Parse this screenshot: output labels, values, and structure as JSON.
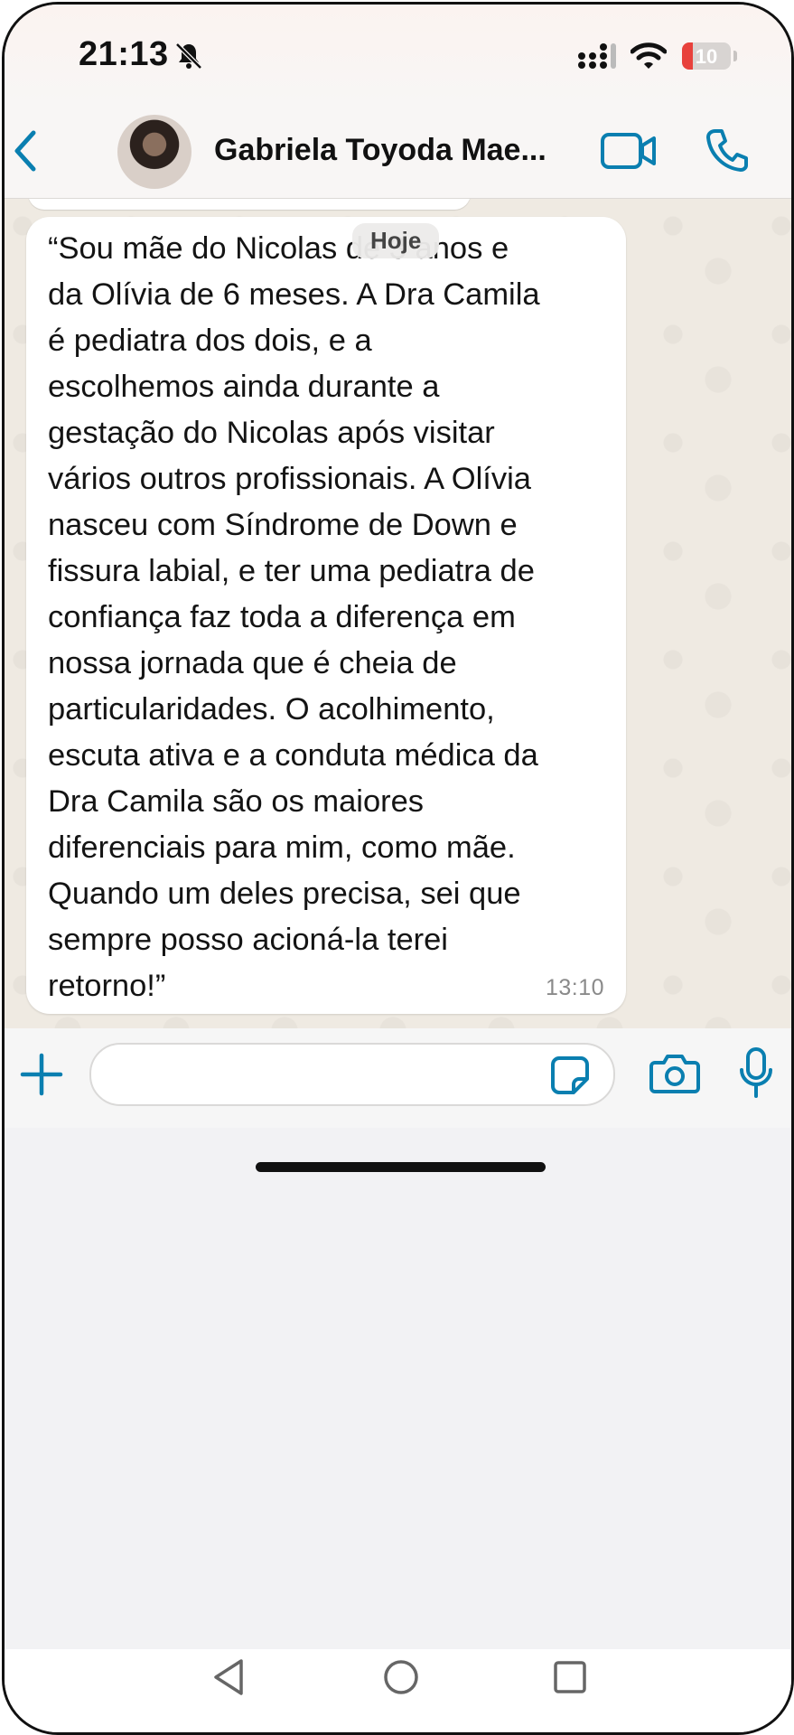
{
  "status_bar": {
    "time": "21:13",
    "battery_level": "10",
    "icons": [
      "bell-slash-icon",
      "signal-icon",
      "wifi-icon",
      "battery-icon"
    ]
  },
  "header": {
    "contact_name": "Gabriela Toyoda Mae...",
    "icons": [
      "chevron-left-icon",
      "video-camera-icon",
      "phone-icon"
    ]
  },
  "chat": {
    "date_label": "Hoje",
    "message": {
      "lines": [
        "“Sou mãe do Nicolas de 3 anos e",
        "da Olívia de 6 meses. A Dra Camila",
        "é pediatra dos dois, e a",
        "escolhemos ainda durante a",
        "gestação do Nicolas após visitar",
        "vários outros profissionais. A Olívia",
        "nasceu com Síndrome de Down e",
        "fissura labial, e ter uma pediatra de",
        "confiança faz toda a diferença em",
        "nossa jornada que é cheia de",
        "particularidades. O acolhimento,",
        "escuta ativa e a conduta médica da",
        "Dra Camila são os maiores",
        "diferenciais para mim, como mãe.",
        "Quando um deles precisa, sei que",
        "sempre posso acioná-la terei",
        "retorno!”"
      ],
      "time": "13:10"
    }
  },
  "input_bar": {
    "text_value": "",
    "icons": [
      "plus-icon",
      "sticker-icon",
      "camera-icon",
      "microphone-icon"
    ]
  },
  "colors": {
    "accent": "#0a7fb0",
    "chat_background": "#efeae2",
    "bubble": "#ffffff",
    "battery_low": "#e8413c"
  }
}
